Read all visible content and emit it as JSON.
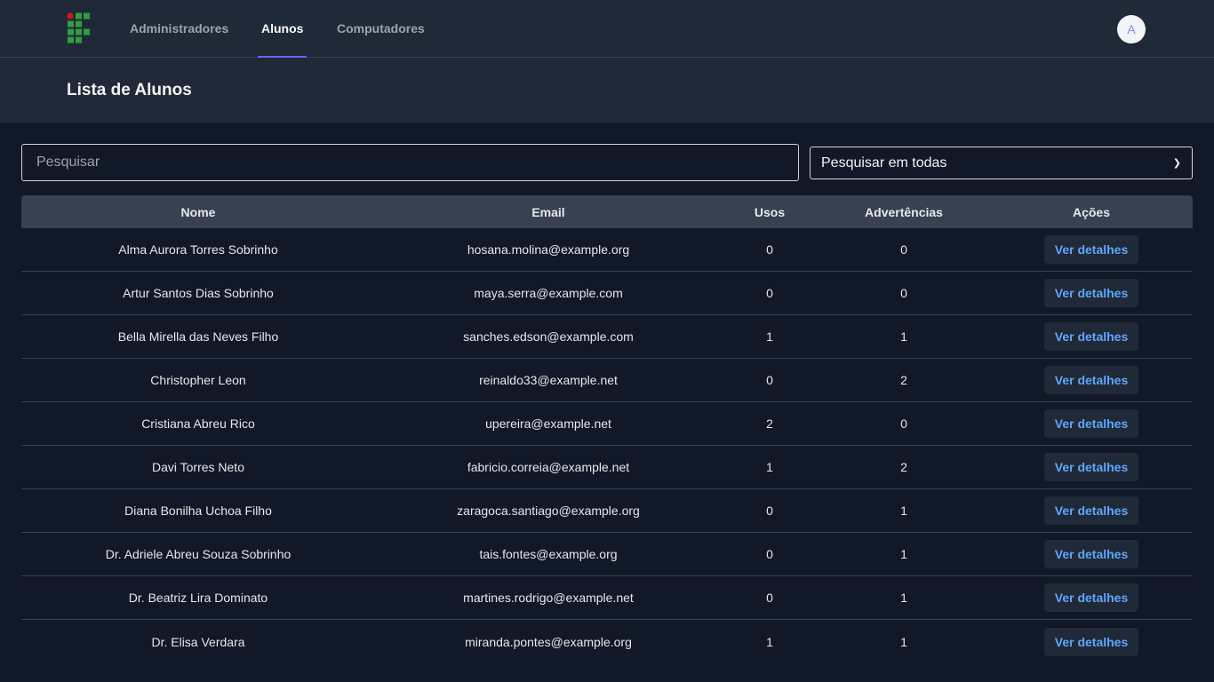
{
  "nav": {
    "links": [
      {
        "label": "Administradores",
        "active": false
      },
      {
        "label": "Alunos",
        "active": true
      },
      {
        "label": "Computadores",
        "active": false
      }
    ],
    "avatar_initial": "A"
  },
  "page": {
    "title": "Lista de Alunos"
  },
  "search": {
    "placeholder": "Pesquisar",
    "value": "",
    "filter_selected": "Pesquisar em todas"
  },
  "table": {
    "columns": [
      "Nome",
      "Email",
      "Usos",
      "Advertências",
      "Ações"
    ],
    "action_label": "Ver detalhes",
    "rows": [
      {
        "nome": "Alma Aurora Torres Sobrinho",
        "email": "hosana.molina@example.org",
        "usos": "0",
        "advertencias": "0"
      },
      {
        "nome": "Artur Santos Dias Sobrinho",
        "email": "maya.serra@example.com",
        "usos": "0",
        "advertencias": "0"
      },
      {
        "nome": "Bella Mirella das Neves Filho",
        "email": "sanches.edson@example.com",
        "usos": "1",
        "advertencias": "1"
      },
      {
        "nome": "Christopher Leon",
        "email": "reinaldo33@example.net",
        "usos": "0",
        "advertencias": "2"
      },
      {
        "nome": "Cristiana Abreu Rico",
        "email": "upereira@example.net",
        "usos": "2",
        "advertencias": "0"
      },
      {
        "nome": "Davi Torres Neto",
        "email": "fabricio.correia@example.net",
        "usos": "1",
        "advertencias": "2"
      },
      {
        "nome": "Diana Bonilha Uchoa Filho",
        "email": "zaragoca.santiago@example.org",
        "usos": "0",
        "advertencias": "1"
      },
      {
        "nome": "Dr. Adriele Abreu Souza Sobrinho",
        "email": "tais.fontes@example.org",
        "usos": "0",
        "advertencias": "1"
      },
      {
        "nome": "Dr. Beatriz Lira Dominato",
        "email": "martines.rodrigo@example.net",
        "usos": "0",
        "advertencias": "1"
      },
      {
        "nome": "Dr. Elisa Verdara",
        "email": "miranda.pontes@example.org",
        "usos": "1",
        "advertencias": "1"
      }
    ]
  },
  "colors": {
    "background": "#111827",
    "surface": "#1f2937",
    "accent": "#6366f1",
    "link": "#60a5fa",
    "logo_green": "#2f9e41",
    "logo_red": "#cd191e"
  }
}
